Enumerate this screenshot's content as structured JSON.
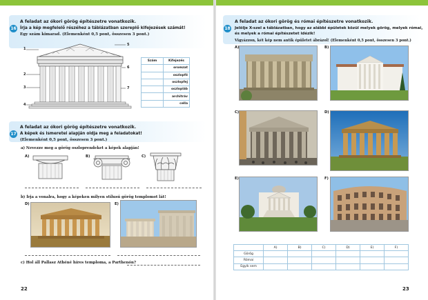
{
  "left_page": {
    "task1": {
      "number": "16",
      "header": "A feladat az ókori görög építészetre vonatkozik.",
      "instruction": "Írja a kép megfelelő részéhez a táblázatban szereplő kifejezések számát!",
      "instruction2": "Egy szám kimarad. (Elemenként 0,5 pont, összesen 3 pont.)",
      "callouts": [
        "1",
        "2",
        "3",
        "4",
        "5",
        "6",
        "7"
      ],
      "table_headers": [
        "Szám",
        "Kifejezés"
      ],
      "terms": [
        "oromzat",
        "oszlopfő",
        "oszlopfej",
        "oszlopláb",
        "architráv",
        "cella"
      ]
    },
    "task2": {
      "number": "17",
      "header": "A feladat az ókori görög építészetre vonatkozik.",
      "instruction": "A képek és ismeretei alapján oldja meg a feladatokat!",
      "points": "(Elemenként 0,5 pont, összesen 3 pont.)",
      "q_a": "a) Nevezze meg a görög oszloprendeket a képek alapján!",
      "capital_labels": [
        "A)",
        "B)",
        "C)"
      ],
      "q_b": "b) Írja a vonalra, hogy a képeken milyen stílusú görög templomot lát!",
      "photo_labels": [
        "D)",
        "E)"
      ],
      "q_c": "c) Hol áll Pallasz Athéné híres temploma, a Parthenón?"
    },
    "page_number": "22"
  },
  "right_page": {
    "task3": {
      "number": "18",
      "header": "A feladat az ókori görög és római építészetre vonatkozik.",
      "instruction": "Jelölje X-szel a táblázatban, hogy az alábbi épületek közül melyek görög, melyek római,",
      "instruction2": "és melyek a római építészetet idézik!",
      "instruction3": "Vigyázzon, két kép nem antik épületet ábrázol! (Elemenként 0,5 pont, összesen 3 pont.)",
      "photo_labels": [
        "A)",
        "B)",
        "C)",
        "D)",
        "E)",
        "F)"
      ],
      "table_columns": [
        "A)",
        "B)",
        "C)",
        "D)",
        "E)",
        "F)"
      ],
      "table_rows": [
        "Görög",
        "Római",
        "Egyik sem"
      ]
    },
    "page_number": "23"
  },
  "colors": {
    "accent_green": "#8cc43a",
    "badge_blue": "#1f8ec9",
    "banner_blue": "#d9ecf9",
    "table_border": "#9fc6df"
  }
}
